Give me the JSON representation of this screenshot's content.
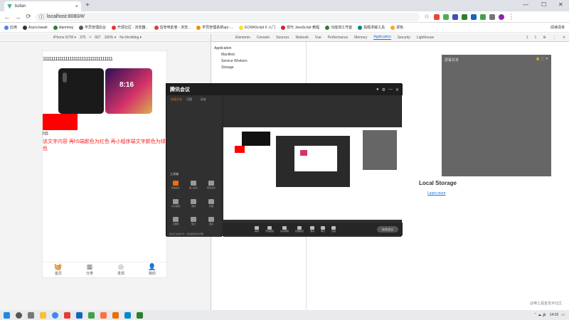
{
  "browser": {
    "tab_title": "bufan",
    "tab_close": "×",
    "new_tab": "+",
    "window_controls": [
      "—",
      "☐",
      "✕"
    ],
    "url": "localhost:8080/#/",
    "bookmarks": [
      "应用",
      "Async/await",
      "dianming",
      "学员管理后台",
      "开源社区 - 浏览器...",
      "信管电影卷 - 浏览...",
      "学员管理系统api -...",
      "ECMAScript 6 入门",
      "现代 JavaScript 教程",
      "功能测工作室",
      "拍题求解工具",
      "源色"
    ],
    "other_bookmarks": "阅读清单"
  },
  "device_toolbar": {
    "device": "iPhone 6/7/8 ▾",
    "width": "375",
    "height": "667",
    "zoom": "100% ▾",
    "throttling": "No throttling ▾"
  },
  "page": {
    "ones_line": "1111111111111111111111111111111111",
    "h5_label": "h5",
    "h5_text": "该文字内容 再h5端颜色为红色 再小程序端文字颜色为绿色",
    "tabs": [
      {
        "label": "首页",
        "icon": "basket-icon"
      },
      {
        "label": "分类",
        "icon": "grid-icon"
      },
      {
        "label": "发现",
        "icon": "compass-icon"
      },
      {
        "label": "我的",
        "icon": "user-icon"
      }
    ]
  },
  "devtools": {
    "tabs": [
      "Elements",
      "Console",
      "Sources",
      "Network",
      "Vue",
      "Performance",
      "Memory",
      "Application",
      "Security",
      "Lighthouse"
    ],
    "active_tab": "Application",
    "error_count": "1",
    "warning_count": "1",
    "sidebar_heading": "Application",
    "sidebar_items": [
      "Manifest",
      "Service Workers",
      "Storage"
    ],
    "main_title": "Local Storage",
    "learn_more": "Learn more"
  },
  "gray_box": {
    "title": "屏幕共享",
    "controls": "🔒 ⬚ ✕"
  },
  "overlay_app": {
    "logo": "腾讯会议",
    "left_tabs": [
      "快速开始",
      "日程",
      "历史"
    ],
    "tools_label": "工具箱",
    "tools": [
      "快速会议",
      "加入会议",
      "预定会议",
      "共享屏幕",
      "录制",
      "管理",
      "云录制",
      "笔记",
      "更多"
    ],
    "bottom_items": [
      "静音",
      "开启视频",
      "共享屏幕",
      "管理成员",
      "邀请",
      "聊天",
      "应用"
    ],
    "cta": "结束会议",
    "footer_note": "会议正在进行中，点击返回会议界面"
  },
  "taskbar": {
    "time": "14:02",
    "watermark": "@稀土掘金技术社区"
  },
  "colors": {
    "red": "#ff0000",
    "link": "#1a73e8",
    "overlay_bg": "#2a2a2a"
  }
}
